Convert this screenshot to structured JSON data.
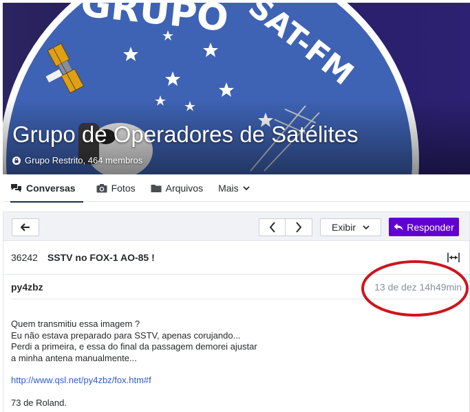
{
  "banner": {
    "logo_text": "GRUPO SAT-FM",
    "title": "Grupo de Operadores de Satélites",
    "meta": "Grupo Restrito, 464 membros"
  },
  "tabs": [
    {
      "label": "Conversas",
      "icon": "conversations-icon",
      "active": true
    },
    {
      "label": "Fotos",
      "icon": "camera-icon",
      "active": false
    },
    {
      "label": "Arquivos",
      "icon": "folder-icon",
      "active": false
    },
    {
      "label": "Mais",
      "icon": "chevron-down-icon",
      "active": false
    }
  ],
  "toolbar": {
    "view_label": "Exibir",
    "reply_label": "Responder"
  },
  "thread": {
    "id": "36242",
    "subject": "SSTV no FOX-1 AO-85 !"
  },
  "message": {
    "author": "py4zbz",
    "date": "13 de dez 14h49min",
    "lines": [
      "Quem transmitiu essa imagem ?",
      "Eu não estava preparado para SSTV, apenas corujando...",
      "Perdi a primeira, e essa do  final da passagem demorei ajustar",
      "a minha antena manualmente..."
    ],
    "link": "http://www.qsl.net/py4zbz/fox.htm#f",
    "signoff": "73 de Roland."
  },
  "colors": {
    "accent": "#6001d2",
    "annotation": "#d0141c",
    "link": "#2d5bc7"
  }
}
